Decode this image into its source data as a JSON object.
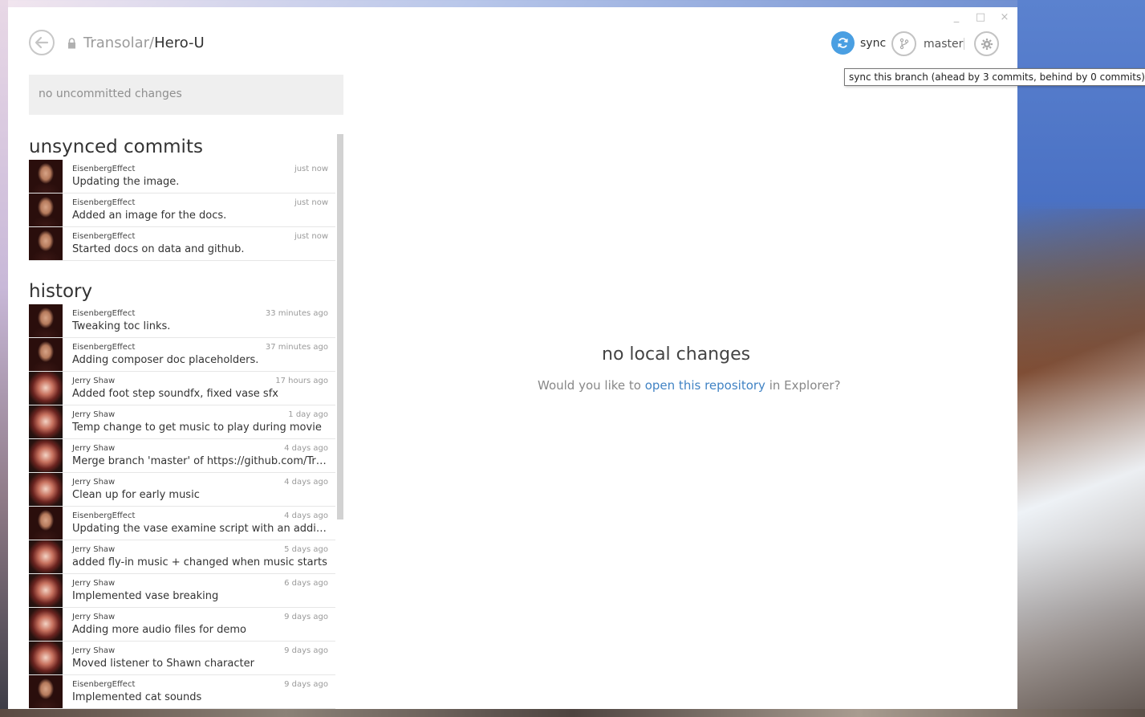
{
  "window": {
    "controls": {
      "minimize": "_",
      "maximize": "□",
      "close": "×"
    }
  },
  "header": {
    "owner": "Transolar/",
    "repo": "Hero-U",
    "sync_label": "sync",
    "branch_label": "master",
    "accent_color": "#4a9fe2"
  },
  "tooltip": {
    "text": "sync this branch (ahead by 3 commits, behind by 0 commits)"
  },
  "sidebar": {
    "uncommitted_text": "no uncommitted changes",
    "unsynced_heading": "unsynced commits",
    "history_heading": "history",
    "unsynced": [
      {
        "author": "EisenbergEffect",
        "time": "just now",
        "message": "Updating the image.",
        "avatar": "eisenberg"
      },
      {
        "author": "EisenbergEffect",
        "time": "just now",
        "message": "Added an image for the docs.",
        "avatar": "eisenberg"
      },
      {
        "author": "EisenbergEffect",
        "time": "just now",
        "message": "Started docs on data and github.",
        "avatar": "eisenberg"
      }
    ],
    "history": [
      {
        "author": "EisenbergEffect",
        "time": "33 minutes ago",
        "message": "Tweaking toc links.",
        "avatar": "eisenberg"
      },
      {
        "author": "EisenbergEffect",
        "time": "37 minutes ago",
        "message": "Adding composer doc placeholders.",
        "avatar": "eisenberg"
      },
      {
        "author": "Jerry Shaw",
        "time": "17 hours ago",
        "message": "Added foot step soundfx, fixed vase sfx",
        "avatar": "jerry"
      },
      {
        "author": "Jerry Shaw",
        "time": "1 day ago",
        "message": "Temp change to get music to play during movie",
        "avatar": "jerry"
      },
      {
        "author": "Jerry Shaw",
        "time": "4 days ago",
        "message": "Merge branch 'master' of https://github.com/Tran...",
        "avatar": "jerry"
      },
      {
        "author": "Jerry Shaw",
        "time": "4 days ago",
        "message": "Clean up for early music",
        "avatar": "jerry"
      },
      {
        "author": "EisenbergEffect",
        "time": "4 days ago",
        "message": "Updating the vase examine script with an additio...",
        "avatar": "eisenberg"
      },
      {
        "author": "Jerry Shaw",
        "time": "5 days ago",
        "message": "added fly-in music + changed when music starts",
        "avatar": "jerry"
      },
      {
        "author": "Jerry Shaw",
        "time": "6 days ago",
        "message": "Implemented vase breaking",
        "avatar": "jerry"
      },
      {
        "author": "Jerry Shaw",
        "time": "9 days ago",
        "message": "Adding more audio files for demo",
        "avatar": "jerry"
      },
      {
        "author": "Jerry Shaw",
        "time": "9 days ago",
        "message": "Moved listener to Shawn character",
        "avatar": "jerry"
      },
      {
        "author": "EisenbergEffect",
        "time": "9 days ago",
        "message": "Implemented cat sounds",
        "avatar": "eisenberg"
      }
    ]
  },
  "main": {
    "empty_title": "no local changes",
    "empty_prefix": "Would you like to ",
    "empty_link": "open this repository",
    "empty_suffix": " in Explorer?"
  }
}
